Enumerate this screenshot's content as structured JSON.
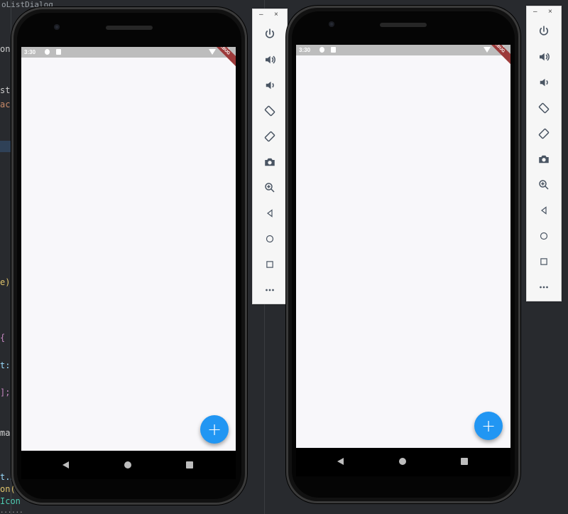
{
  "ide": {
    "tab_label": "oListDialog",
    "code_fragments": [
      "ont",
      "st,",
      "ac",
      "e)",
      "{",
      "t:",
      "];",
      "ma",
      "t.n",
      "on(",
      "Icon",
      "......"
    ]
  },
  "left_device": {
    "status": {
      "time": "3:30",
      "banner": "DEBUG"
    },
    "fab_label": "+"
  },
  "right_device": {
    "status": {
      "time": "3:30",
      "banner": "DEBUG"
    },
    "fab_label": "+"
  },
  "toolbar": {
    "minimize_label": "–",
    "close_label": "×",
    "buttons": [
      "power",
      "volume-up",
      "volume-down",
      "rotate-left",
      "rotate-right",
      "screenshot",
      "zoom",
      "back",
      "home",
      "overview",
      "more"
    ]
  },
  "colors": {
    "fab": "#2196f3",
    "screen_bg": "#f8f7fa",
    "statusbar": "#bdbdbd",
    "banner": "#9c3a3a"
  }
}
